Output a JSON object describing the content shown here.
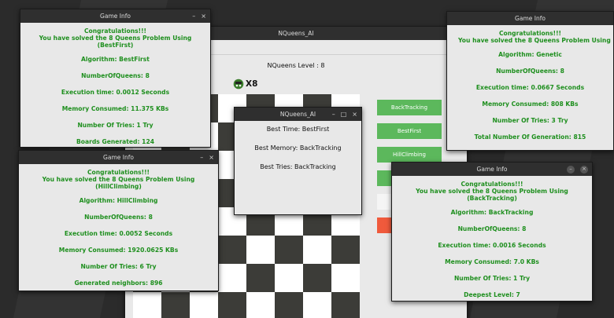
{
  "main_window": {
    "title": "NQueens_AI",
    "level_text": "NQueens Level : 8",
    "queen_count_text": "X8",
    "buttons": [
      "BackTracking",
      "BestFirst",
      "HillClimbing"
    ],
    "board_size": 8
  },
  "stats_window": {
    "title": "NQueens_AI",
    "best_time": "Best Time: BestFirst",
    "best_memory": "Best Memory: BackTracking",
    "best_tries": "Best Tries: BackTracking"
  },
  "info_windows": [
    {
      "title": "Game Info",
      "congrats": "Congratulations!!!",
      "solved": "You have solved the 8 Queens Problem Using (BestFirst)",
      "lines": [
        "Algorithm: BestFirst",
        "NumberOfQueens: 8",
        "Execution time: 0.0012 Seconds",
        "Memory Consumed: 11.375 KBs",
        "Number Of Tries: 1 Try",
        "Boards Generated: 124"
      ]
    },
    {
      "title": "Game Info",
      "congrats": "Congratulations!!!",
      "solved": "You have solved the 8 Queens Problem Using (HillClimbing)",
      "lines": [
        "Algorithm: HillClimbing",
        "NumberOfQueens: 8",
        "Execution time: 0.0052 Seconds",
        "Memory Consumed: 1920.0625 KBs",
        "Number Of Tries: 6 Try",
        "Generated neighbors: 896"
      ]
    },
    {
      "title": "Game Info",
      "congrats": "Congratulations!!!",
      "solved": "You have solved the 8 Queens Problem Using (Genetic",
      "lines": [
        "Algorithm: Genetic",
        "NumberOfQueens: 8",
        "Execution time: 0.0667 Seconds",
        "Memory Consumed: 808 KBs",
        "Number Of Tries: 3 Try",
        "Total Number Of Generation: 815"
      ]
    },
    {
      "title": "Game Info",
      "congrats": "Congratulations!!!",
      "solved": "You have solved the 8 Queens Problem Using (BackTracking)",
      "lines": [
        "Algorithm: BackTracking",
        "NumberOfQueens: 8",
        "Execution time: 0.0016 Seconds",
        "Memory Consumed: 7.0 KBs",
        "Number Of Tries: 1 Try",
        "Deepest Level: 7"
      ]
    }
  ],
  "colors": {
    "success_text": "#1e8f1e",
    "button_green": "#5cb85c",
    "button_red": "#f05a3c",
    "titlebar": "#2f2f2f"
  },
  "icons": {
    "minimize": "–",
    "maximize": "□",
    "close": "×"
  }
}
